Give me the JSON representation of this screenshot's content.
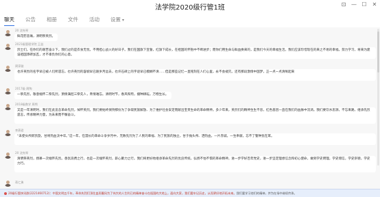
{
  "window": {
    "title": "法学院2020级行管1班",
    "controls": [
      "pin-icon",
      "minimize-icon",
      "maximize-icon",
      "close-icon"
    ],
    "control_glyphs": [
      "⊡",
      "—",
      "☐",
      "✕"
    ]
  },
  "tabs": [
    {
      "label": "聊天",
      "active": true
    },
    {
      "label": "公告"
    },
    {
      "label": "相册"
    },
    {
      "label": "文件"
    },
    {
      "label": "活动"
    },
    {
      "label": "设置",
      "caret": "▾"
    }
  ],
  "messages": [
    {
      "sender": "20 沈先琴",
      "text": "鲜花慰悲痛，清明祭英烈。"
    },
    {
      "sender": "2021级管理学院 王益",
      "text": "烈士们，在你们的艰苦奋斗下，我们过的是衣食无忧，不用担心战火的好日子。我们在国旗下宣誓，红旗下成长，在祖国的怀抱中不断进步；而你们用生命与鲜血换来的，是我们今天的幸福生活。我们应该珍惜现在的来之不易的幸福，努力学习，将来为建设祖国添砖加瓦，才不辜负你们的心意。"
    },
    {
      "sender": "周家骏",
      "text": "也许英烈的名字早已被人们所遗忘，也许英烈的容貌早已随岁月远去，也许石碑上的字迹早已模糊不清……但是那些记忆一直铭刻在人们心里，永不会褪灭。还有那段激情中国梦，正一点一点清晰起来"
    },
    {
      "sender": "2017级 周陶",
      "text": "一祭先烈，敬意缅怀二祭先烈，萧情满腔三祭先人，青情难忘。清明时节，春风和煦，播种耕耘，万物生长。"
    },
    {
      "sender": "2018级数学 周煦",
      "text": "又是一年清明时，我们在此追念革命先烈，悼怀英烈。我们要始终保持那份为了争取民族解放、为了维护社会安定而献出宝贵生命的革命精神。多少年来，英烈们的精神生生不息，红色基因一直在我们的血脉中流淌。我们要饮水思源，不忘来路，继承先烈遗志，传承精神力量，为未来而不懈奋斗。"
    },
    {
      "sender": "李燕君",
      "text": "“未使头颅新凯旋，甘将热血沃中华。”这一年，在漫长的革命斗争岁月中，无数先烈为了人民的幸福、为了民族的独立，甘于抛头颅、洒热血，一片赤诚，一生奉献。忘不了警钟犹在耳。"
    },
    {
      "sender": "20 沈先琴",
      "text": "清明祭英烈，扬慕一次缅怀先烈。香氛浪费之行，也是一次缅怀英烈，薪心聚力之行。我们将更好地继承革命先烈的优良传统，弘扬不怕不惧的革命精神，进一步学好百年党史，进一步坚定理想信念和初心使命，做到学史明理，学史增信，学史崇德，学史力行。"
    },
    {
      "sender": "蒋仁勇",
      "text": ""
    }
  ],
  "footer": {
    "notice": "20级行管快讯群(2221460712)：中国文明五千年，革命先烈们顶住血雨腥风为了伟大的人生利已的精神奋斗在祖国的大地上，面向大家，我们要牢记历史，从而更好地开拓未来。",
    "rest": "我们要学习他们的精神，并为在场中继续传承。"
  }
}
